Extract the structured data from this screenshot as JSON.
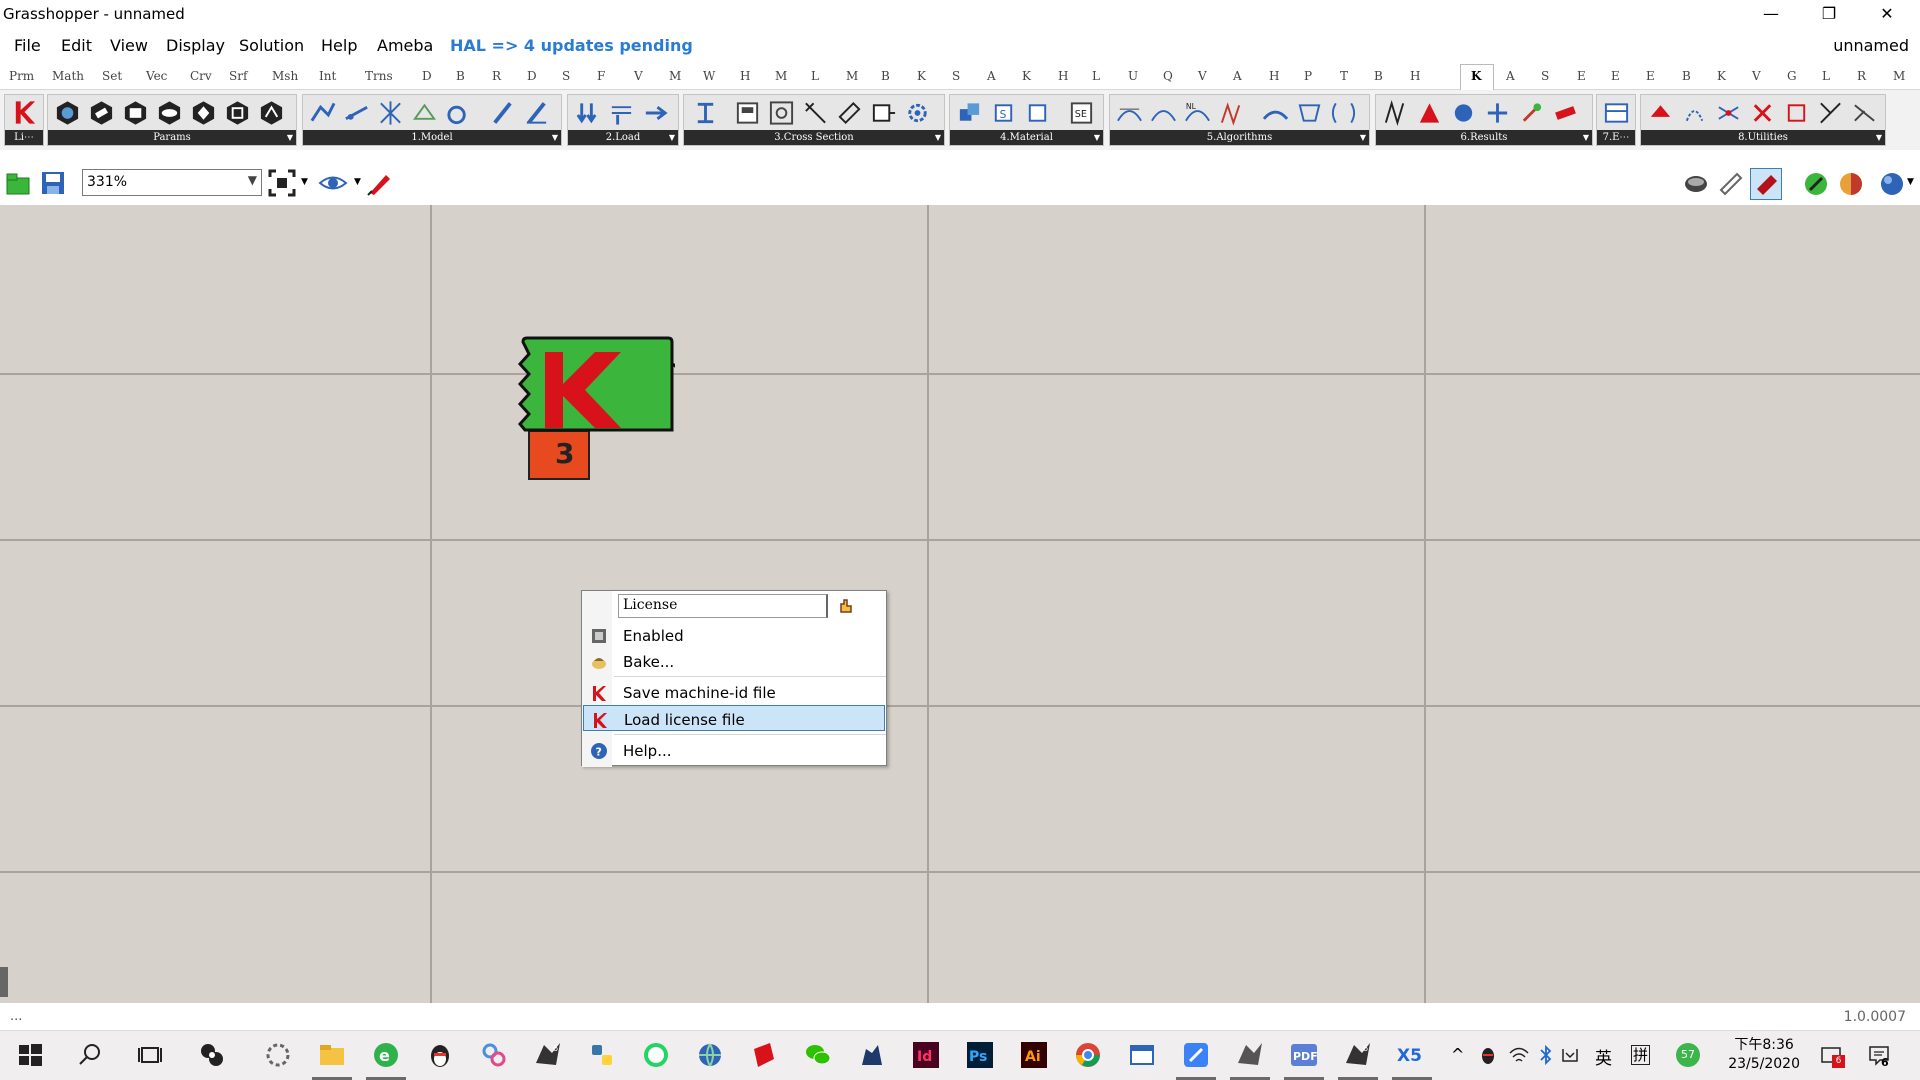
{
  "window": {
    "title": "Grasshopper - unnamed",
    "minimize": "—",
    "maximize": "❐",
    "close": "✕"
  },
  "menu": {
    "items": [
      "File",
      "Edit",
      "View",
      "Display",
      "Solution",
      "Help",
      "Ameba"
    ],
    "hal": "HAL => 4 updates pending",
    "document": "unnamed"
  },
  "tabs": [
    "Prm",
    "Math",
    "Set",
    "Vec",
    "Crv",
    "Srf",
    "Msh",
    "Int",
    "Trns",
    "D",
    "B",
    "R",
    "D",
    "S",
    "F",
    "V",
    "M",
    "W",
    "H",
    "M",
    "L",
    "M",
    "B",
    "K",
    "S",
    "A",
    "K",
    "H",
    "L",
    "U",
    "Q",
    "V",
    "A",
    "H",
    "P",
    "T",
    "B",
    "H",
    "K",
    "A",
    "S",
    "E",
    "E",
    "E",
    "B",
    "K",
    "V",
    "G",
    "L",
    "R",
    "M"
  ],
  "active_tab": "K",
  "ribbon": {
    "groups": [
      "Li⋯",
      "Params",
      "1.Model",
      "2.Load",
      "3.Cross Section",
      "4.Material",
      "5.Algorithms",
      "6.Results",
      "7.E⋯",
      "8.Utilities"
    ]
  },
  "toolbar": {
    "zoom": "331%"
  },
  "component": {
    "output_text": "3"
  },
  "context_menu": {
    "input_value": "License",
    "items": {
      "enabled": "Enabled",
      "bake": "Bake...",
      "save_machine_id": "Save machine-id file",
      "load_license": "Load license file",
      "help": "Help..."
    }
  },
  "status": {
    "left": "...",
    "version": "1.0.0007"
  },
  "taskbar": {
    "time": "下午8:36",
    "date": "23/5/2020",
    "ime": "英",
    "ime2": "拼",
    "badge_notify": "6",
    "badge_app": "6",
    "net_percent": "57"
  },
  "colors": {
    "canvas": "#d6d2cb",
    "grid": "#a8a49d",
    "component_green": "#3bb53b",
    "component_output": "#e84a1f",
    "hal_blue": "#2a7bd3",
    "menu_highlight": "#cce4f7"
  }
}
